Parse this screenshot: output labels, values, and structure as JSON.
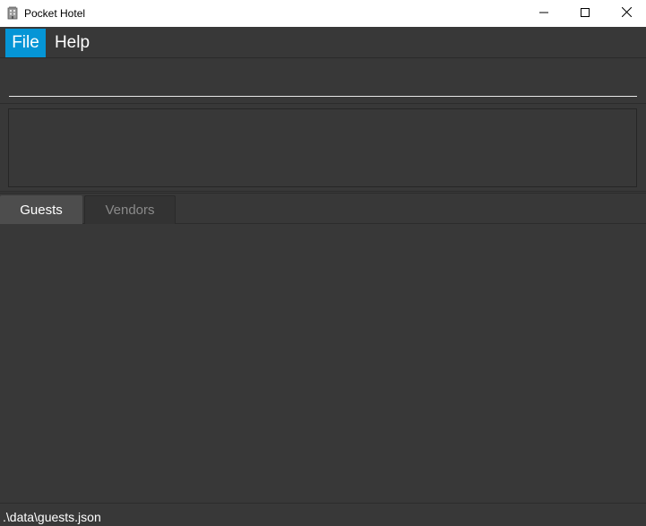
{
  "window": {
    "title": "Pocket Hotel",
    "icon": "hotel-building-icon",
    "controls": [
      "minimize-icon",
      "maximize-icon",
      "close-icon"
    ]
  },
  "menu": {
    "items": [
      {
        "label": "File",
        "selected": true
      },
      {
        "label": "Help",
        "selected": false
      }
    ]
  },
  "command": {
    "value": "",
    "placeholder": ""
  },
  "result": {
    "text": ""
  },
  "tabs": [
    {
      "label": "Guests",
      "active": true
    },
    {
      "label": "Vendors",
      "active": false
    }
  ],
  "status": {
    "path": ".\\data\\guests.json"
  },
  "colors": {
    "accent": "#0595d6",
    "background": "#383838",
    "titlebar": "#ffffff"
  }
}
